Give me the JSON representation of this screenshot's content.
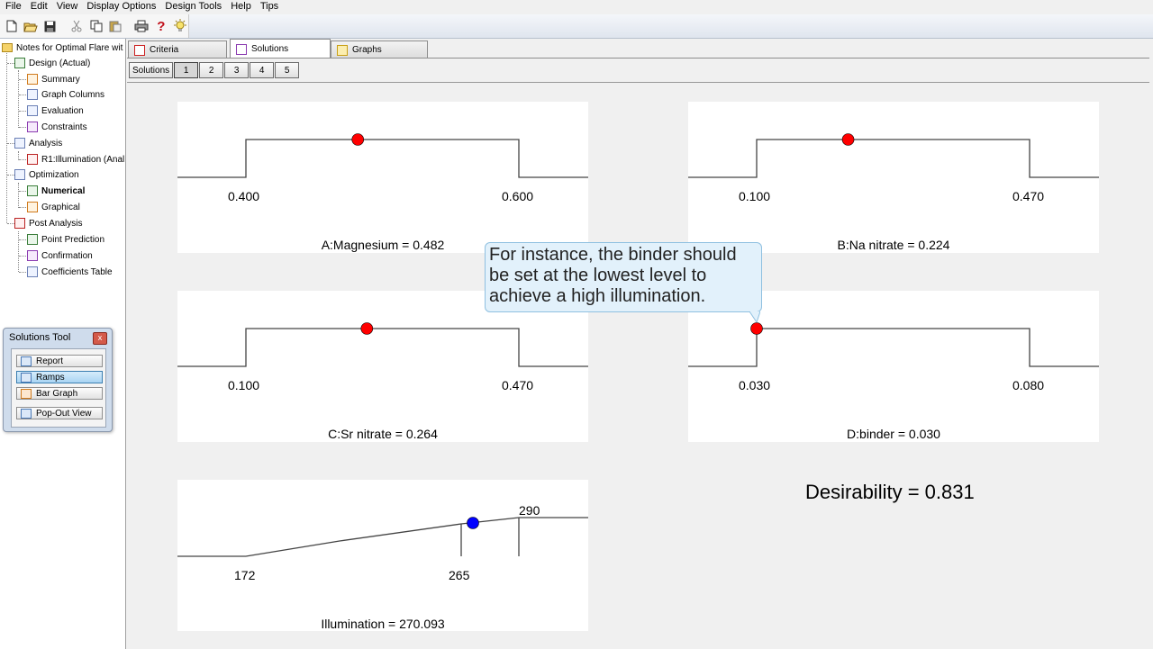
{
  "menu": [
    "File",
    "Edit",
    "View",
    "Display Options",
    "Design Tools",
    "Help",
    "Tips"
  ],
  "toolbar": {
    "icons": [
      "new-file-icon",
      "open-folder-icon",
      "save-icon",
      "cut-icon",
      "copy-icon",
      "paste-icon",
      "print-icon",
      "help-icon",
      "tip-bulb-icon"
    ]
  },
  "tree": {
    "root": "Notes for Optimal Flare wit",
    "design": "Design (Actual)",
    "summary": "Summary",
    "graph_columns": "Graph Columns",
    "evaluation": "Evaluation",
    "constraints": "Constraints",
    "analysis": "Analysis",
    "r1": "R1:Illumination (Anal",
    "optimization": "Optimization",
    "numerical": "Numerical",
    "graphical": "Graphical",
    "post_analysis": "Post Analysis",
    "point_prediction": "Point Prediction",
    "confirmation": "Confirmation",
    "coefficients": "Coefficients Table"
  },
  "solutions_tool": {
    "title": "Solutions Tool",
    "close": "x",
    "report": "Report",
    "ramps": "Ramps",
    "bar_graph": "Bar Graph",
    "pop_out": "Pop-Out View"
  },
  "tabs": {
    "criteria": "Criteria",
    "solutions": "Solutions",
    "graphs": "Graphs"
  },
  "subtabs": {
    "label": "Solutions",
    "items": [
      "1",
      "2",
      "3",
      "4",
      "5"
    ],
    "active": "1"
  },
  "ramps": [
    {
      "title": "A:Magnesium = 0.482",
      "low": "0.400",
      "high": "0.600",
      "value": 0.482,
      "min": 0.4,
      "max": 0.6
    },
    {
      "title": "B:Na nitrate = 0.224",
      "low": "0.100",
      "high": "0.470",
      "value": 0.224,
      "min": 0.1,
      "max": 0.47
    },
    {
      "title": "C:Sr nitrate = 0.264",
      "low": "0.100",
      "high": "0.470",
      "value": 0.264,
      "min": 0.1,
      "max": 0.47
    },
    {
      "title": "D:binder = 0.030",
      "low": "0.030",
      "high": "0.080",
      "value": 0.03,
      "min": 0.03,
      "max": 0.08
    }
  ],
  "response": {
    "title": "Illumination = 270.093",
    "low": "172",
    "target": "265",
    "high": "290",
    "value": 270.093
  },
  "desirability": "Desirability = 0.831",
  "callout": "For instance, the binder should be set at the lowest level to achieve a high illumination.",
  "colors": {
    "factor_dot": "#ff0000",
    "response_dot": "#0000ff",
    "callout_bg": "#e2f1fb"
  }
}
